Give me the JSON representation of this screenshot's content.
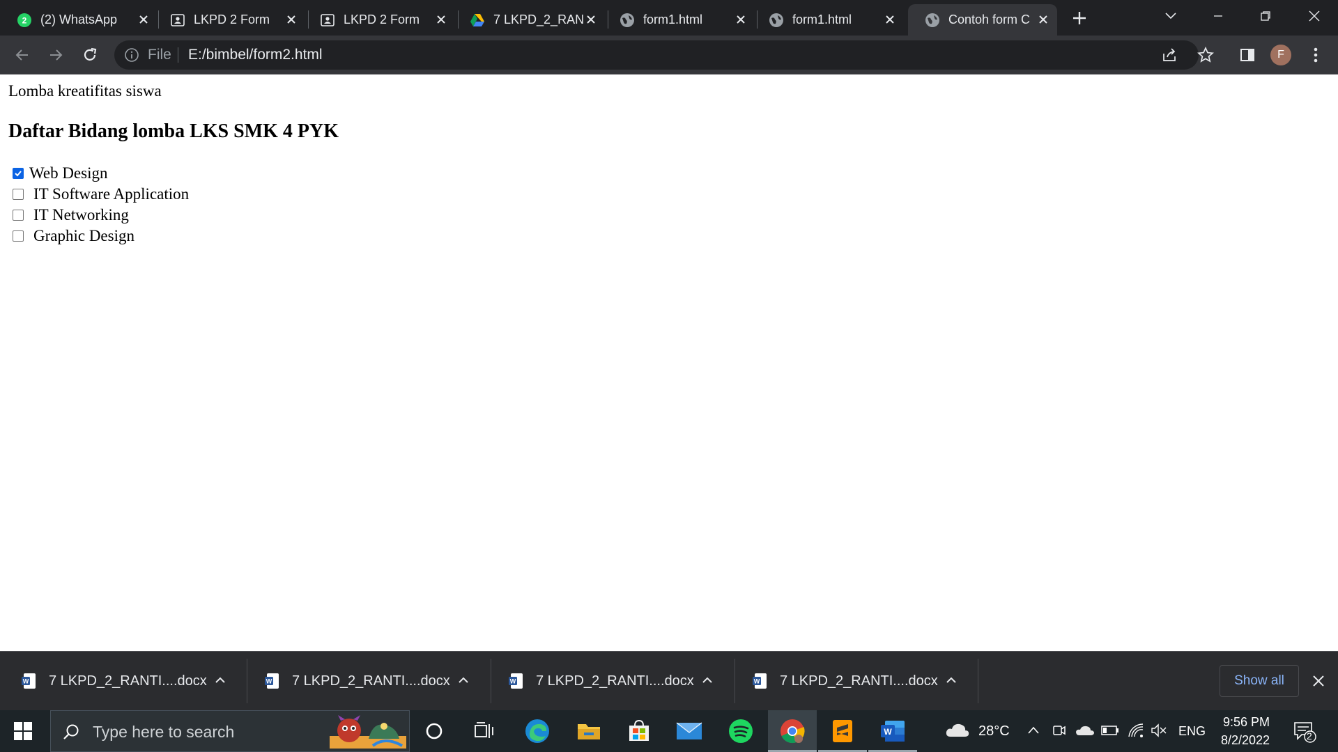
{
  "browser": {
    "tabs": [
      {
        "title": "(2) WhatsApp",
        "icon": "whatsapp-icon",
        "badge": "2",
        "active": false
      },
      {
        "title": "LKPD 2 Form",
        "icon": "form-icon",
        "active": false
      },
      {
        "title": "LKPD 2 Form",
        "icon": "form-icon",
        "active": false
      },
      {
        "title": "7 LKPD_2_RAN",
        "icon": "google-drive-icon",
        "active": false
      },
      {
        "title": "form1.html",
        "icon": "globe-icon",
        "active": false
      },
      {
        "title": "form1.html",
        "icon": "globe-icon",
        "active": false
      },
      {
        "title": "Contoh form C",
        "icon": "globe-icon",
        "active": true
      }
    ],
    "omnibox": {
      "scheme_label": "File",
      "url": "E:/bimbel/form2.html"
    },
    "profile_initial": "F"
  },
  "page": {
    "intro": "Lomba kreatifitas siswa",
    "heading": "Daftar Bidang lomba LKS SMK 4 PYK",
    "options": [
      {
        "label": "Web Design",
        "checked": true
      },
      {
        "label": "IT Software Application",
        "checked": false
      },
      {
        "label": "IT Networking",
        "checked": false
      },
      {
        "label": "Graphic Design",
        "checked": false
      }
    ]
  },
  "downloads": {
    "items": [
      {
        "filename": "7 LKPD_2_RANTI....docx"
      },
      {
        "filename": "7 LKPD_2_RANTI....docx"
      },
      {
        "filename": "7 LKPD_2_RANTI....docx"
      },
      {
        "filename": "7 LKPD_2_RANTI....docx"
      }
    ],
    "show_all_label": "Show all"
  },
  "taskbar": {
    "search_placeholder": "Type here to search",
    "pinned": [
      "cortana-icon",
      "task-view-icon",
      "edge-icon",
      "file-explorer-icon",
      "microsoft-store-icon",
      "mail-icon",
      "spotify-icon",
      "chrome-icon",
      "sublime-text-icon",
      "word-icon"
    ],
    "weather": "28°C",
    "language": "ENG",
    "time": "9:56 PM",
    "date": "8/2/2022",
    "notification_count": "2"
  },
  "colors": {
    "tabstrip": "#202124",
    "toolbar": "#35363a",
    "checkbox_accent": "#0b63e4",
    "show_all_link": "#8ab4f8",
    "taskbar": "#1d2428"
  }
}
